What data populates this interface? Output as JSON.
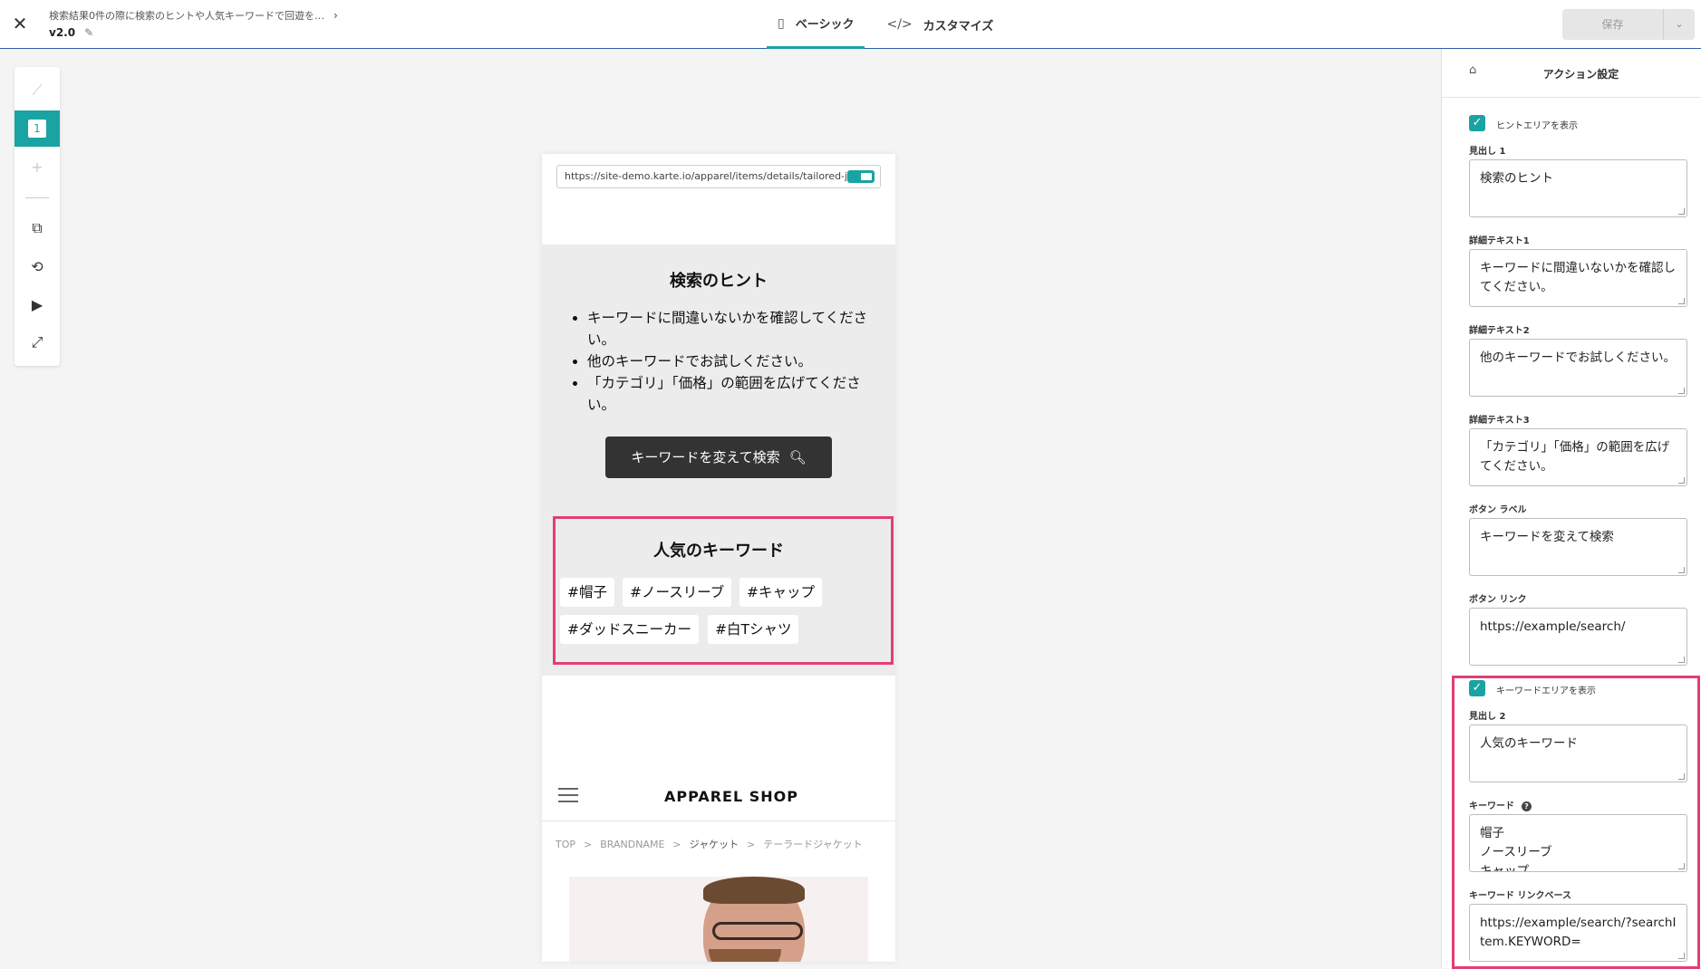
{
  "header": {
    "close_icon": "close-icon",
    "title": "検索結果0件の際に検索のヒントや人気キーワードで回遊を…",
    "version": "v2.0",
    "tabs": [
      {
        "label": "ベーシック",
        "icon": "sidebar-layout-icon",
        "active": true
      },
      {
        "label": "カスタマイズ",
        "icon": "code-icon",
        "active": false
      }
    ],
    "save_label": "保存"
  },
  "left_toolbar": {
    "step_number": "1",
    "items": [
      "hidden-step-icon",
      "step-1",
      "add-step-icon",
      "device-icon",
      "rotate-icon",
      "play-icon",
      "fullscreen-icon"
    ]
  },
  "preview": {
    "url": "https://site-demo.karte.io/apparel/items/details/tailored-jacket",
    "hint_heading": "検索のヒント",
    "hint_items": [
      "キーワードに間違いないかを確認してください。",
      "他のキーワードでお試しください。",
      "「カテゴリ」「価格」の範囲を広げてください。"
    ],
    "button_label": "キーワードを変えて検索",
    "popular_heading": "人気のキーワード",
    "tags": [
      "#帽子",
      "#ノースリーブ",
      "#キャップ",
      "#ダッドスニーカー",
      "#白Tシャツ"
    ],
    "shop_name": "APPAREL SHOP",
    "breadcrumb": [
      "TOP",
      "BRANDNAME",
      "ジャケット",
      "テーラードジャケット"
    ]
  },
  "panel": {
    "title": "アクション設定",
    "hint_area_checkbox": "ヒントエリアを表示",
    "heading1_label": "見出し 1",
    "heading1_value": "検索のヒント",
    "detail1_label": "詳細テキスト1",
    "detail1_value": "キーワードに間違いないかを確認してください。",
    "detail2_label": "詳細テキスト2",
    "detail2_value": "他のキーワードでお試しください。",
    "detail3_label": "詳細テキスト3",
    "detail3_value": "「カテゴリ」「価格」の範囲を広げてください。",
    "button_label_label": "ボタン ラベル",
    "button_label_value": "キーワードを変えて検索",
    "button_link_label": "ボタン リンク",
    "button_link_value": "https://example/search/",
    "keyword_area_checkbox": "キーワードエリアを表示",
    "heading2_label": "見出し 2",
    "heading2_value": "人気のキーワード",
    "keywords_label": "キーワード",
    "keywords_value": "帽子\nノースリーブ\nキャップ",
    "keyword_link_label": "キーワード リンクベース",
    "keyword_link_value": "https://example/search/?searchItem.KEYWORD="
  },
  "colors": {
    "accent": "#1aa3a3",
    "highlight": "#e33d7a",
    "header_border": "#2a5ea8"
  }
}
